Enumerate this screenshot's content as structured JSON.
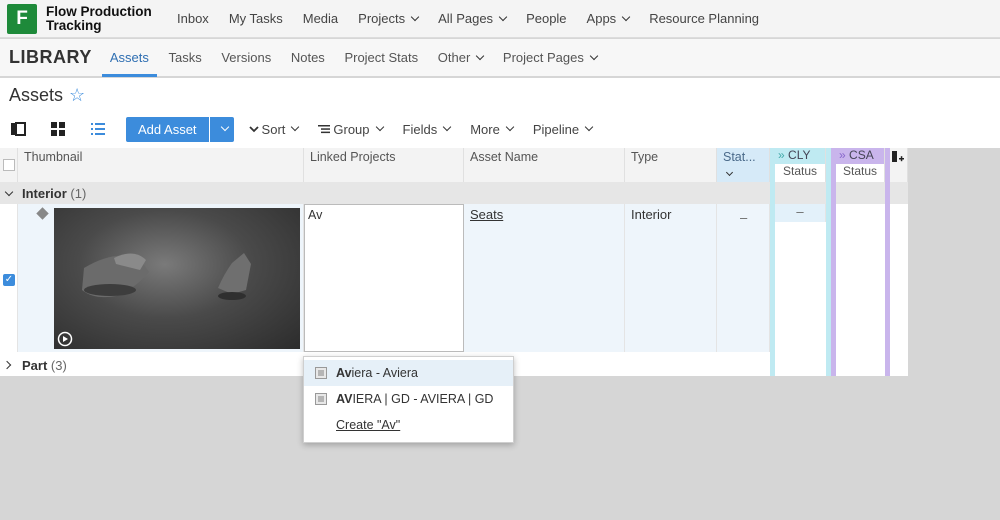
{
  "app": {
    "logo_letter": "F",
    "title_line1": "Flow Production",
    "title_line2": "Tracking"
  },
  "topnav": [
    {
      "label": "Inbox"
    },
    {
      "label": "My Tasks"
    },
    {
      "label": "Media"
    },
    {
      "label": "Projects"
    },
    {
      "label": "All Pages"
    },
    {
      "label": "People"
    },
    {
      "label": "Apps"
    },
    {
      "label": "Resource Planning"
    }
  ],
  "subbar": {
    "library": "LIBRARY",
    "tabs": [
      "Assets",
      "Tasks",
      "Versions",
      "Notes",
      "Project Stats",
      "Other",
      "Project Pages"
    ],
    "active_tab": "Assets"
  },
  "page": {
    "title": "Assets",
    "star": "☆"
  },
  "toolbar": {
    "add_asset": "Add Asset",
    "sort": "Sort",
    "group": "Group",
    "fields": "Fields",
    "more": "More",
    "pipeline": "Pipeline"
  },
  "columns": {
    "thumbnail": "Thumbnail",
    "linked_projects": "Linked Projects",
    "asset_name": "Asset Name",
    "type": "Type",
    "status": "Stat...",
    "cly": "CLY",
    "cly_sub": "Status",
    "csa": "CSA",
    "csa_sub": "Status",
    "cly_marker": "»",
    "csa_marker": "»"
  },
  "groups": [
    {
      "name": "Interior",
      "count": "(1)"
    },
    {
      "name": "Part",
      "count": "(3)"
    }
  ],
  "row": {
    "linked_projects_input": "Av",
    "asset_name": "Seats",
    "type": "Interior",
    "status": "–",
    "cly_status": "–",
    "checked": true
  },
  "popup": {
    "items": [
      {
        "bold": "Av",
        "rest": "iera - Aviera"
      },
      {
        "bold": "AV",
        "rest": "IERA | GD - AVIERA | GD"
      }
    ],
    "create": "Create \"Av\""
  },
  "colors": {
    "accent": "#3c8cdc",
    "logo": "#1e8a3a",
    "cly": "#bfeaf2",
    "csa": "#c9b5ec"
  }
}
